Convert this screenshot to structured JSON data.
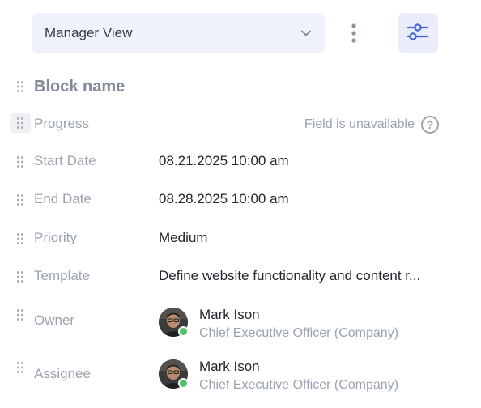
{
  "toolbar": {
    "view_select_value": "Manager View",
    "icons": {
      "chevron": "chevron-down-icon",
      "more": "more-vertical-icon",
      "filter": "sliders-icon"
    }
  },
  "block": {
    "title": "Block name"
  },
  "fields": {
    "progress": {
      "label": "Progress",
      "unavailable_text": "Field is unavailable",
      "help": "?"
    },
    "start_date": {
      "label": "Start Date",
      "value": "08.21.2025 10:00 am"
    },
    "end_date": {
      "label": "End Date",
      "value": "08.28.2025 10:00 am"
    },
    "priority": {
      "label": "Priority",
      "value": "Medium"
    },
    "template": {
      "label": "Template",
      "value": "Define website functionality and content r..."
    },
    "owner": {
      "label": "Owner",
      "name": "Mark Ison",
      "role": "Chief Executive Officer (Company)",
      "online": true
    },
    "assignee": {
      "label": "Assignee",
      "name": "Mark Ison",
      "role": "Chief Executive Officer (Company)",
      "online": true
    }
  },
  "colors": {
    "accent": "#4a63d8",
    "muted": "#9aa3b0",
    "online": "#4cc36a"
  }
}
